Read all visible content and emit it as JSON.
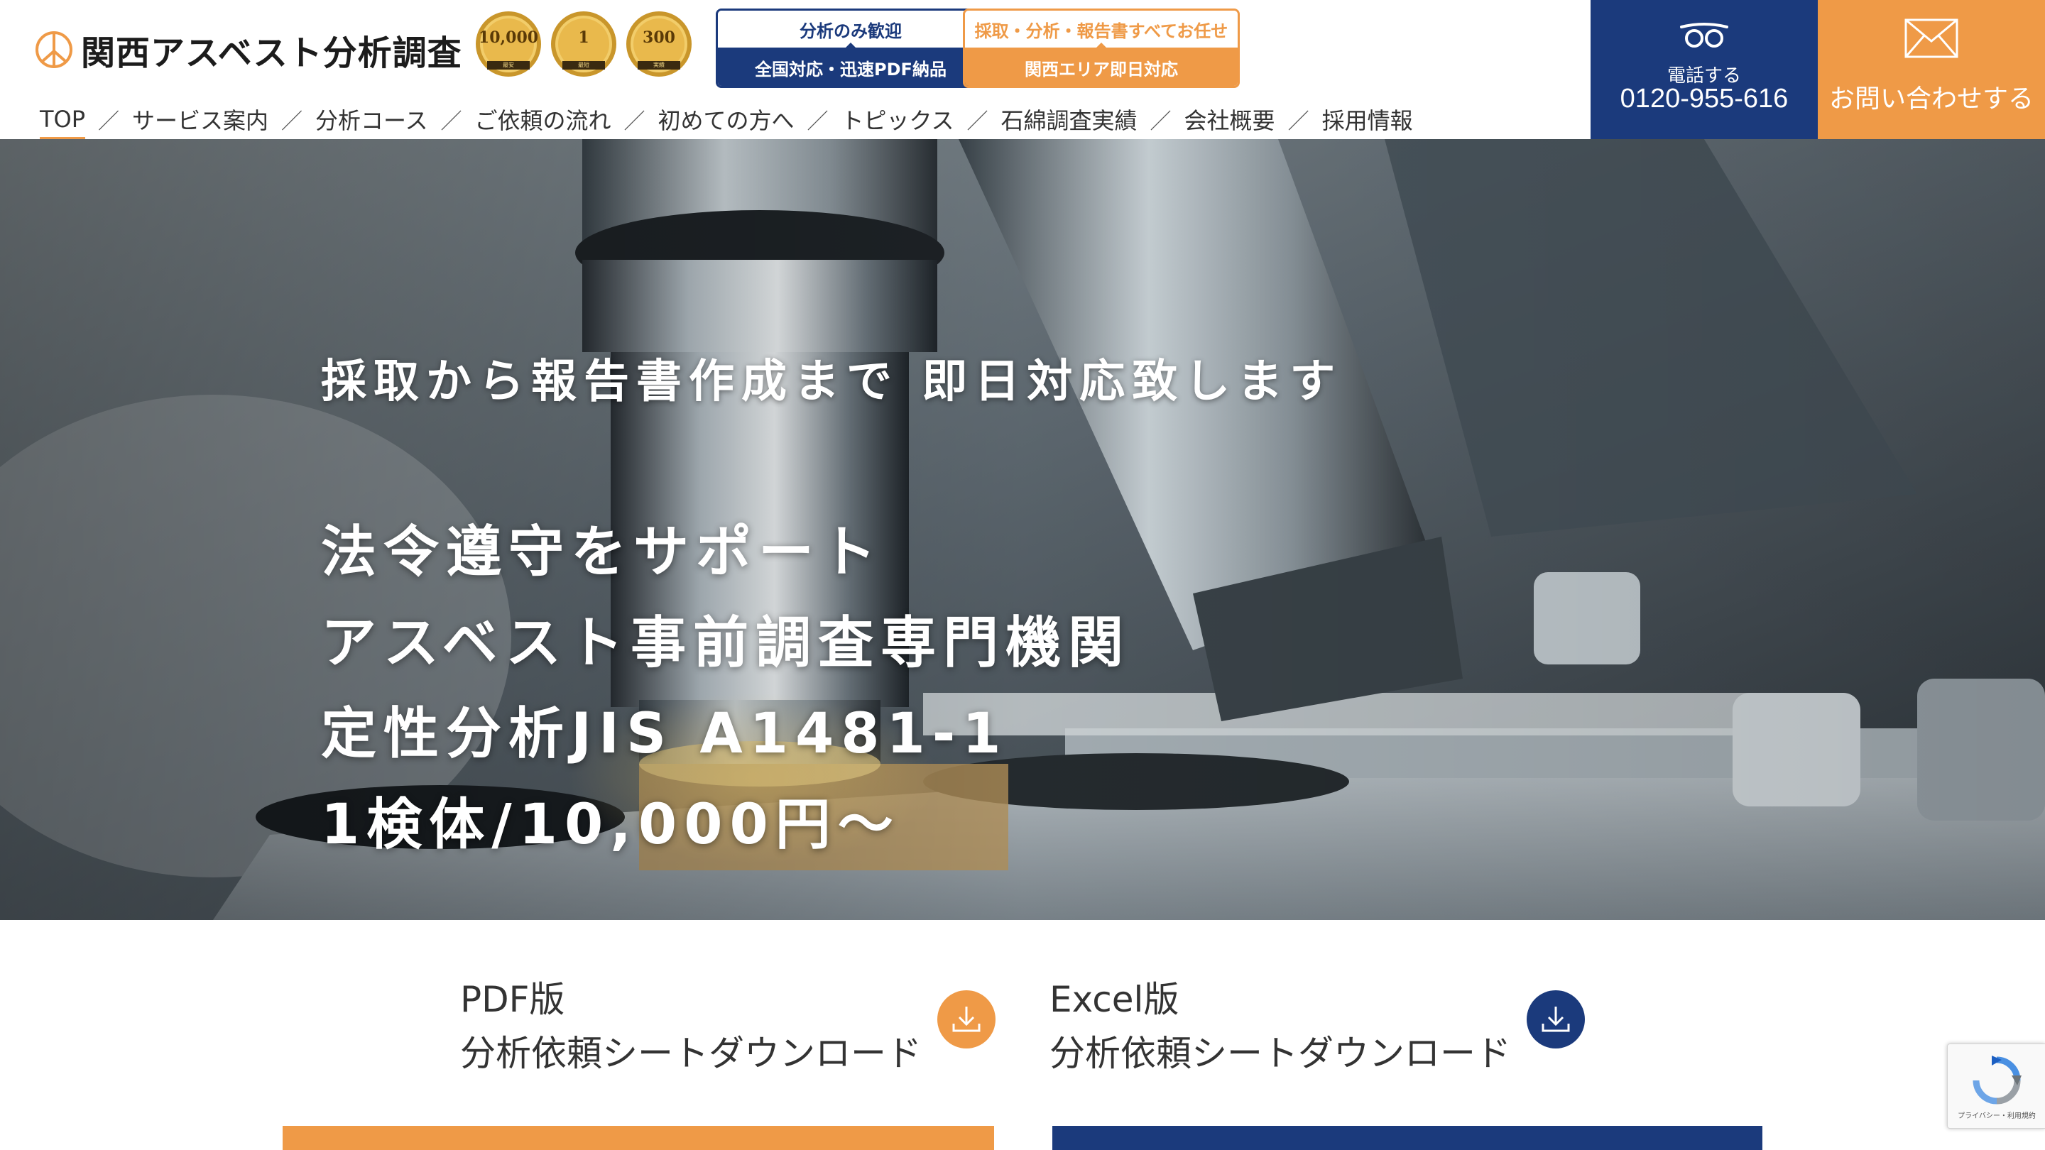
{
  "site": {
    "logo_text": "関西アスベスト分析調査",
    "medals": [
      {
        "value": "10,000",
        "sub": "最安"
      },
      {
        "value": "1",
        "sub": "最短"
      },
      {
        "value": "300",
        "sub": "実績"
      }
    ]
  },
  "badges": {
    "navy": {
      "top": "分析のみ歓迎",
      "bottom": "全国対応・迅速PDF納品"
    },
    "orange": {
      "top": "採取・分析・報告書すべてお任せ",
      "bottom": "関西エリア即日対応"
    }
  },
  "nav": {
    "items": [
      {
        "label": "TOP",
        "active": true
      },
      {
        "label": "サービス案内"
      },
      {
        "label": "分析コース"
      },
      {
        "label": "ご依頼の流れ"
      },
      {
        "label": "初めての方へ"
      },
      {
        "label": "トピックス"
      },
      {
        "label": "石綿調査実績"
      },
      {
        "label": "会社概要"
      },
      {
        "label": "採用情報"
      }
    ],
    "separator": "／"
  },
  "cta": {
    "phone_label": "電話する",
    "phone_number": "0120-955-616",
    "phone_icon": "free-dial-icon",
    "mail_label": "お問い合わせする",
    "mail_icon": "envelope-icon"
  },
  "hero": {
    "lead": "採取から報告書作成まで 即日対応致します",
    "lines": [
      "法令遵守をサポート",
      "アスベスト事前調査専門機関",
      "定性分析JIS A1481-1",
      "1検体/10,000円～"
    ]
  },
  "downloads": {
    "pdf": {
      "line1": "PDF版",
      "line2": "分析依頼シートダウンロード",
      "icon": "download-icon"
    },
    "excel": {
      "line1": "Excel版",
      "line2": "分析依頼シートダウンロード",
      "icon": "download-icon"
    }
  },
  "recaptcha": {
    "text": "プライバシー・利用規約"
  },
  "colors": {
    "navy": "#1b3a7c",
    "orange": "#ef9a47",
    "text": "#333333"
  }
}
